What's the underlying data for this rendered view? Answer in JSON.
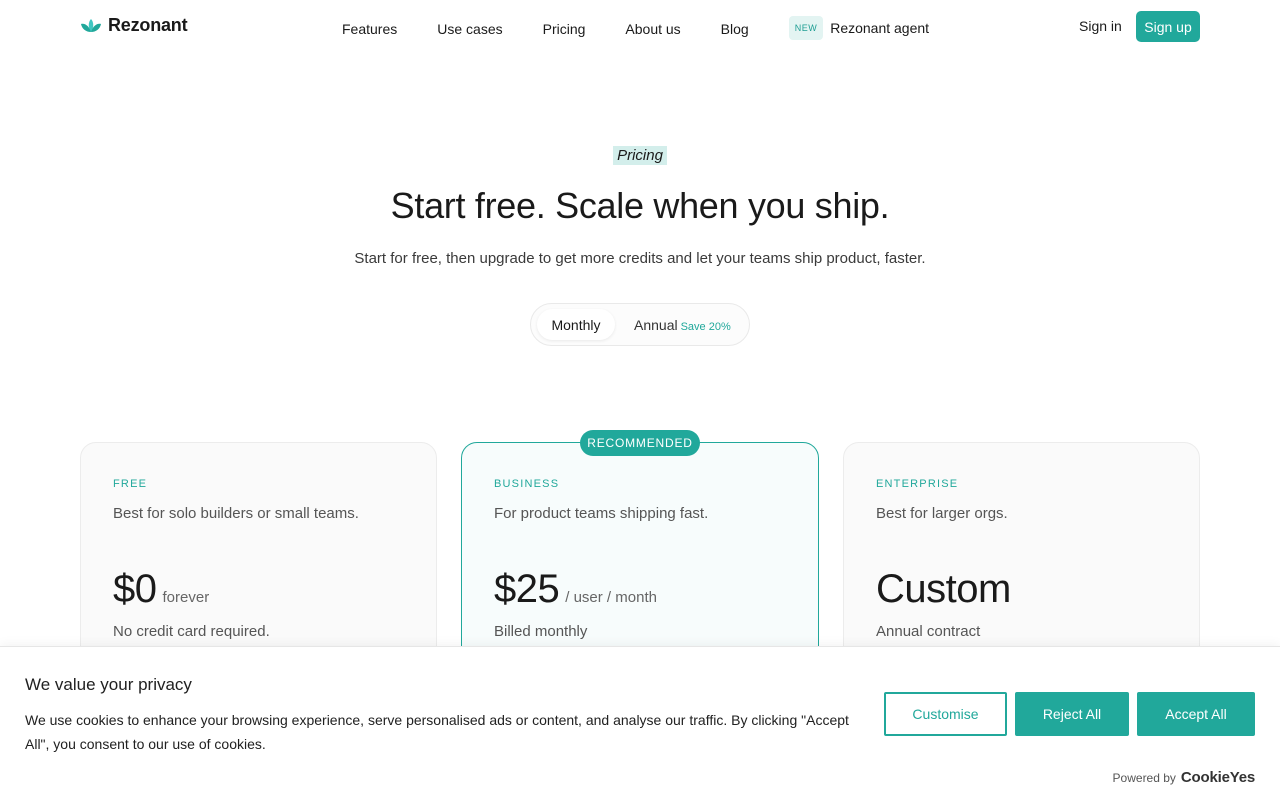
{
  "nav": {
    "brand": "Rezonant",
    "links": [
      "Features",
      "Use cases",
      "Pricing",
      "About us",
      "Blog"
    ],
    "new_badge": "NEW",
    "new_link": "Rezonant agent",
    "sign_in": "Sign in",
    "sign_up": "Sign up",
    "accent": "#21a89b"
  },
  "hero": {
    "eyebrow": "Pricing",
    "title": "Start free. Scale when you ship.",
    "subtitle": "Start for free, then upgrade to get more credits and let your teams ship product, faster."
  },
  "billing_toggle": {
    "monthly": "Monthly",
    "annual": "Annual",
    "save": "Save 20%",
    "selected": "Monthly"
  },
  "plans": [
    {
      "name": "FREE",
      "description": "Best for solo builders or small teams.",
      "price": "$0",
      "unit": "forever",
      "note": "No credit card required."
    },
    {
      "name": "BUSINESS",
      "badge": "RECOMMENDED",
      "description": "For product teams shipping fast.",
      "price": "$25",
      "unit": "/ user / month",
      "note": "Billed monthly"
    },
    {
      "name": "ENTERPRISE",
      "description": "Best for larger orgs.",
      "price": "Custom",
      "unit": "",
      "note": "Annual contract"
    }
  ],
  "cookie_banner": {
    "title": "We value your privacy",
    "text": "We use cookies to enhance your browsing experience, serve personalised ads or content, and analyse our traffic. By clicking \"Accept All\", you consent to our use of cookies.",
    "customise": "Customise",
    "reject": "Reject All",
    "accept": "Accept All",
    "powered_by": "Powered by",
    "powered_brand": "CookieYes"
  }
}
